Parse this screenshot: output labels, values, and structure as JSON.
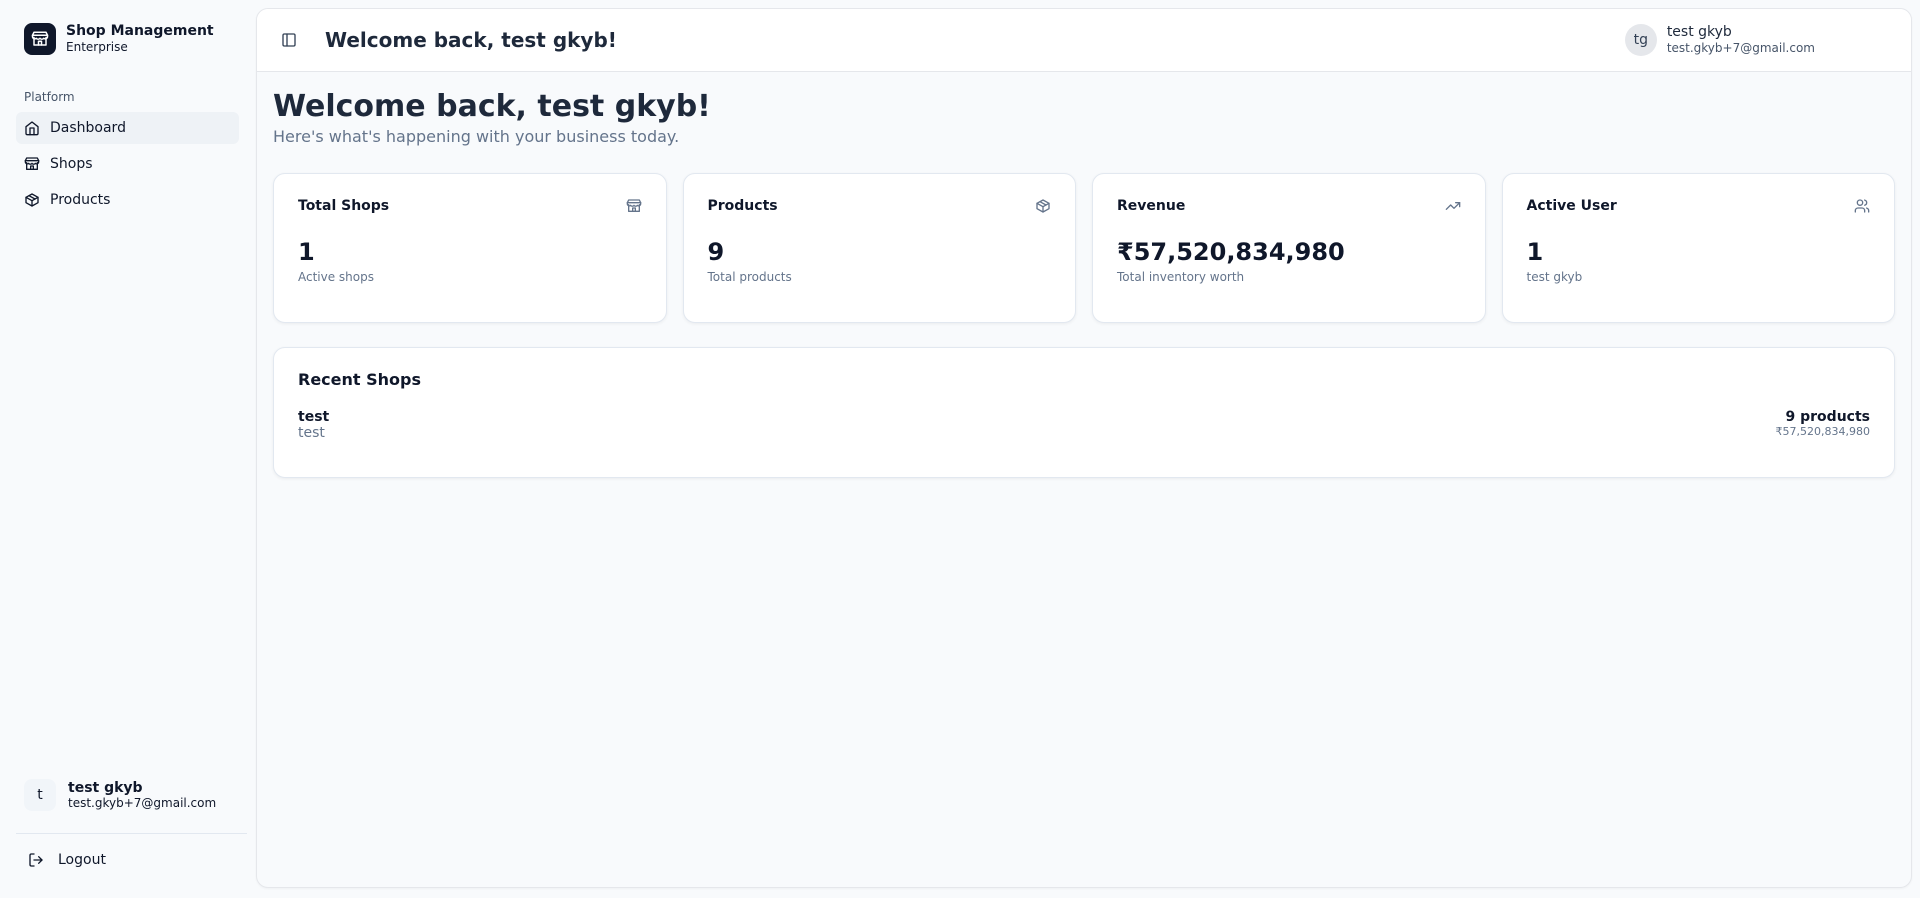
{
  "sidebar": {
    "brand_title": "Shop Management",
    "brand_sub": "Enterprise",
    "section_label": "Platform",
    "items": [
      {
        "label": "Dashboard",
        "icon": "home-icon"
      },
      {
        "label": "Shops",
        "icon": "store-icon"
      },
      {
        "label": "Products",
        "icon": "package-icon"
      }
    ],
    "user": {
      "initial": "t",
      "name": "test gkyb",
      "email": "test.gkyb+7@gmail.com"
    },
    "logout_label": "Logout"
  },
  "topbar": {
    "title": "Welcome back, test gkyb!",
    "user": {
      "initials": "tg",
      "name": "test gkyb",
      "email": "test.gkyb+7@gmail.com"
    }
  },
  "main": {
    "heading": "Welcome back, test gkyb!",
    "subheading": "Here's what's happening with your business today.",
    "stats": [
      {
        "title": "Total Shops",
        "value": "1",
        "desc": "Active shops",
        "icon": "store-icon"
      },
      {
        "title": "Products",
        "value": "9",
        "desc": "Total products",
        "icon": "package-icon"
      },
      {
        "title": "Revenue",
        "value": "₹57,520,834,980",
        "desc": "Total inventory worth",
        "icon": "trending-up-icon"
      },
      {
        "title": "Active User",
        "value": "1",
        "desc": "test gkyb",
        "icon": "users-icon"
      }
    ],
    "recent": {
      "title": "Recent Shops",
      "shops": [
        {
          "name": "test",
          "desc": "test",
          "products": "9 products",
          "worth": "₹57,520,834,980"
        }
      ]
    }
  },
  "colors": {
    "brand_logo_bg": "#0f172a",
    "active_nav_bg": "#eef2f6",
    "muted_text": "#64748b"
  }
}
